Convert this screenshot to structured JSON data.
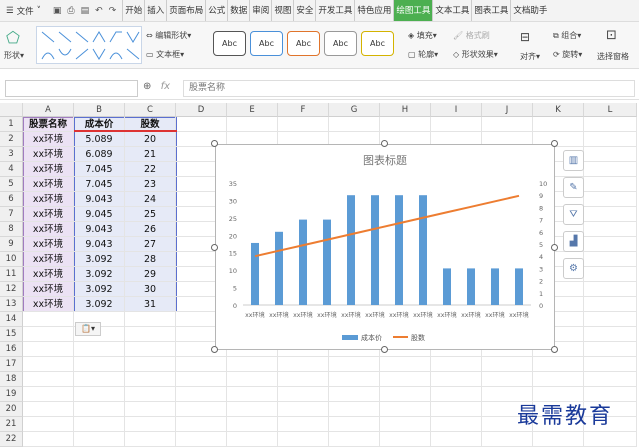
{
  "menu": {
    "file_label": "文件",
    "tabs": [
      "开始",
      "插入",
      "页面布局",
      "公式",
      "数据",
      "审阅",
      "视图",
      "安全",
      "开发工具",
      "特色应用",
      "绘图工具",
      "文本工具",
      "图表工具",
      "文档助手"
    ],
    "active_tab": "绘图工具"
  },
  "ribbon": {
    "shape_label": "形状",
    "edit_shape": "编辑形状",
    "textbox": "文本框",
    "style_labels": [
      "Abc",
      "Abc",
      "Abc",
      "Abc",
      "Abc"
    ],
    "fill": "填充",
    "outline": "轮廓",
    "format_brush": "格式刷",
    "shape_effect": "形状效果",
    "group": "组合",
    "rotate": "旋转",
    "align": "对齐",
    "select_pane": "选择窗格"
  },
  "formula": {
    "fx": "fx",
    "content": "股票名称"
  },
  "columns": [
    "A",
    "B",
    "C",
    "D",
    "E",
    "F",
    "G",
    "H",
    "I",
    "J",
    "K",
    "L"
  ],
  "table": {
    "headers": [
      "股票名称",
      "成本价",
      "股数"
    ],
    "rows": [
      [
        "xx环境",
        "5.089",
        "20"
      ],
      [
        "xx环境",
        "6.089",
        "21"
      ],
      [
        "xx环境",
        "7.045",
        "22"
      ],
      [
        "xx环境",
        "7.045",
        "23"
      ],
      [
        "xx环境",
        "9.043",
        "24"
      ],
      [
        "xx环境",
        "9.045",
        "25"
      ],
      [
        "xx环境",
        "9.043",
        "26"
      ],
      [
        "xx环境",
        "9.043",
        "27"
      ],
      [
        "xx环境",
        "3.092",
        "28"
      ],
      [
        "xx环境",
        "3.092",
        "29"
      ],
      [
        "xx环境",
        "3.092",
        "30"
      ],
      [
        "xx环境",
        "3.092",
        "31"
      ]
    ]
  },
  "row_numbers": [
    "1",
    "2",
    "3",
    "4",
    "5",
    "6",
    "7",
    "8",
    "9",
    "10",
    "11",
    "12",
    "13",
    "14",
    "15",
    "16",
    "17",
    "18",
    "19",
    "20",
    "21",
    "22"
  ],
  "chart_data": {
    "type": "bar",
    "title": "图表标题",
    "categories": [
      "xx环境",
      "xx环境",
      "xx环境",
      "xx环境",
      "xx环境",
      "xx环境",
      "xx环境",
      "xx环境",
      "xx环境",
      "xx环境",
      "xx环境",
      "xx环境"
    ],
    "series": [
      {
        "name": "成本价",
        "type": "bar",
        "axis": "left",
        "color": "#5b9bd5",
        "values": [
          17.8,
          21,
          24.5,
          24.5,
          31.5,
          31.5,
          31.5,
          31.5,
          10.5,
          10.5,
          10.5,
          10.5
        ]
      },
      {
        "name": "股数",
        "type": "line",
        "axis": "right",
        "color": "#ed7d31",
        "values": [
          4,
          4.45,
          4.9,
          5.35,
          5.8,
          6.25,
          6.7,
          7.15,
          7.6,
          8.05,
          8.5,
          8.95
        ]
      }
    ],
    "ylim_left": [
      0,
      35
    ],
    "yticks_left": [
      "0",
      "5",
      "10",
      "15",
      "20",
      "25",
      "30",
      "35"
    ],
    "ylim_right": [
      0,
      10
    ],
    "yticks_right": [
      "0",
      "1",
      "2",
      "3",
      "4",
      "5",
      "6",
      "7",
      "8",
      "9",
      "10"
    ],
    "legend_position": "bottom",
    "grid": false
  },
  "watermark": "最需教育"
}
